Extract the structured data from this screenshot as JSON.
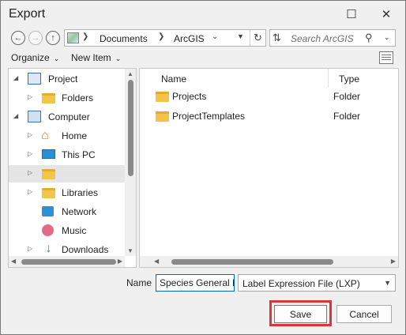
{
  "window": {
    "title": "Export",
    "maximize_icon": "maximize-icon",
    "close_icon": "close-icon"
  },
  "address": {
    "segments": [
      "Documents",
      "ArcGIS"
    ],
    "search_placeholder": "Search ArcGIS"
  },
  "toolbar": {
    "organize": "Organize",
    "new_item": "New Item"
  },
  "tree": [
    {
      "label": "Project",
      "icon": "project-icon",
      "expander": "expanded"
    },
    {
      "label": "Folders",
      "icon": "folder-icon",
      "expander": "collapsed"
    },
    {
      "label": "Computer",
      "icon": "computer-icon",
      "expander": "expanded"
    },
    {
      "label": "Home",
      "icon": "home-icon",
      "expander": "collapsed"
    },
    {
      "label": "This PC",
      "icon": "pc-icon",
      "expander": "collapsed"
    },
    {
      "label": "",
      "icon": "folder-icon",
      "expander": "collapsed"
    },
    {
      "label": "Libraries",
      "icon": "libraries-icon",
      "expander": "collapsed"
    },
    {
      "label": "Network",
      "icon": "network-icon",
      "expander": "none"
    },
    {
      "label": "Music",
      "icon": "music-icon",
      "expander": "none"
    },
    {
      "label": "Downloads",
      "icon": "downloads-icon",
      "expander": "collapsed"
    }
  ],
  "columns": {
    "name": "Name",
    "type": "Type"
  },
  "files": [
    {
      "name": "Projects",
      "type": "Folder"
    },
    {
      "name": "ProjectTemplates",
      "type": "Folder"
    }
  ],
  "save_form": {
    "name_label": "Name",
    "name_value": "Species General N",
    "type_value": "Label Expression File (LXP)"
  },
  "buttons": {
    "save": "Save",
    "cancel": "Cancel"
  },
  "colors": {
    "highlight": "#d9383a",
    "folder": "#f3c44b",
    "focus_border": "#0067c0"
  }
}
